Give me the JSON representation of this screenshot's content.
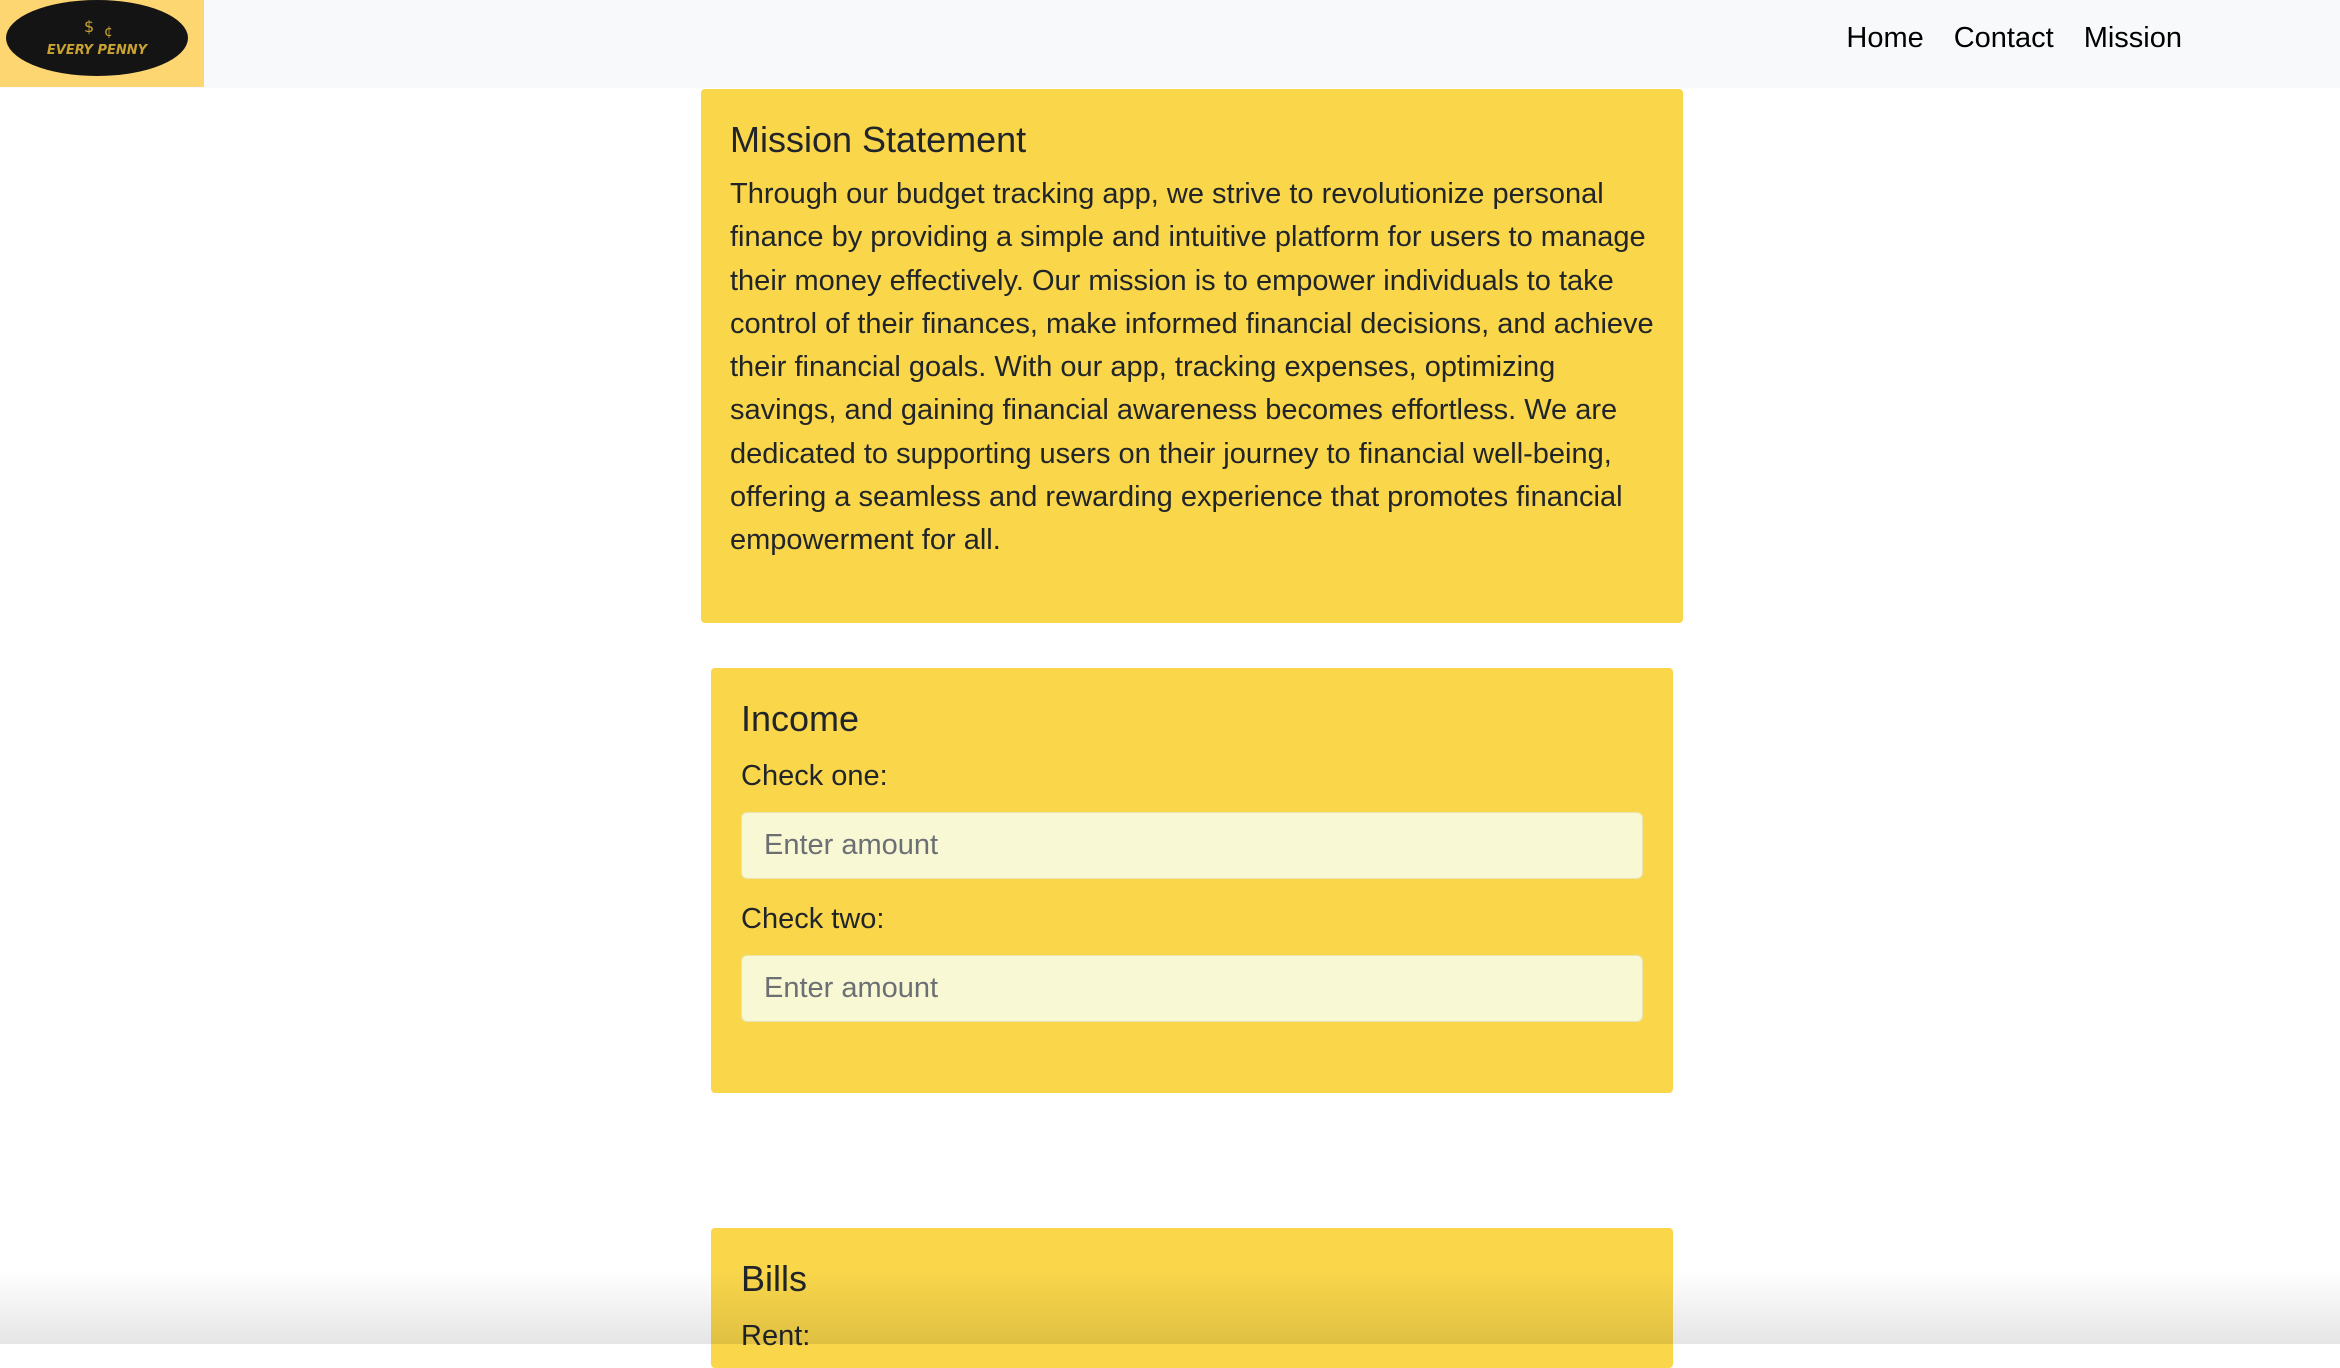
{
  "navbar": {
    "logo_text": "EVERY PENNY",
    "links": [
      "Home",
      "Contact",
      "Mission"
    ]
  },
  "mission": {
    "title": "Mission Statement",
    "text": "Through our budget tracking app, we strive to revolutionize personal finance by providing a simple and intuitive platform for users to manage their money effectively. Our mission is to empower individuals to take control of their finances, make informed financial decisions, and achieve their financial goals. With our app, tracking expenses, optimizing savings, and gaining financial awareness becomes effortless. We are dedicated to supporting users on their journey to financial well-being, offering a seamless and rewarding experience that promotes financial empowerment for all."
  },
  "income": {
    "title": "Income",
    "check_one_label": "Check one:",
    "check_one_placeholder": "Enter amount",
    "check_two_label": "Check two:",
    "check_two_placeholder": "Enter amount"
  },
  "bills": {
    "title": "Bills",
    "rent_label": "Rent:"
  },
  "colors": {
    "card_background": "#f9d64a",
    "logo_background": "#fdd672",
    "navbar_background": "#f8f9fa",
    "input_background": "#f8f8d4"
  }
}
